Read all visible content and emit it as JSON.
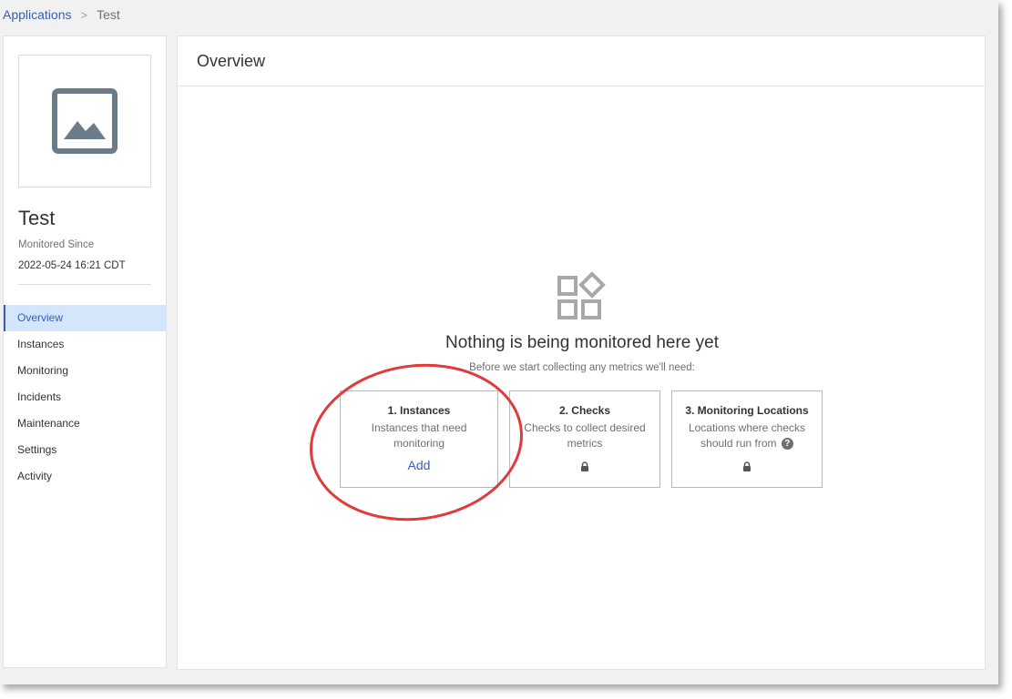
{
  "breadcrumb": {
    "parent": "Applications",
    "separator": ">",
    "current": "Test"
  },
  "sidebar": {
    "app_name": "Test",
    "monitored_since_label": "Monitored Since",
    "monitored_since_value": "2022-05-24 16:21 CDT",
    "image_icon": "image-placeholder-icon",
    "nav": [
      {
        "label": "Overview",
        "active": true
      },
      {
        "label": "Instances",
        "active": false
      },
      {
        "label": "Monitoring",
        "active": false
      },
      {
        "label": "Incidents",
        "active": false
      },
      {
        "label": "Maintenance",
        "active": false
      },
      {
        "label": "Settings",
        "active": false
      },
      {
        "label": "Activity",
        "active": false
      }
    ]
  },
  "main": {
    "header": "Overview",
    "empty_state": {
      "icon": "widgets-icon",
      "title": "Nothing is being monitored here yet",
      "subtitle": "Before we start collecting any metrics we'll need:"
    },
    "steps": [
      {
        "title": "1. Instances",
        "desc": "Instances that need monitoring",
        "action": "Add"
      },
      {
        "title": "2. Checks",
        "desc": "Checks to collect desired metrics",
        "locked": true
      },
      {
        "title": "3. Monitoring Locations",
        "desc": "Locations where checks should run from",
        "help": "?",
        "locked": true
      }
    ]
  },
  "colors": {
    "accent": "#3a5db5",
    "active_nav_bg": "#d3e6fb",
    "annotation_circle": "#e03a3a",
    "icon_gray": "#6b7b88"
  }
}
